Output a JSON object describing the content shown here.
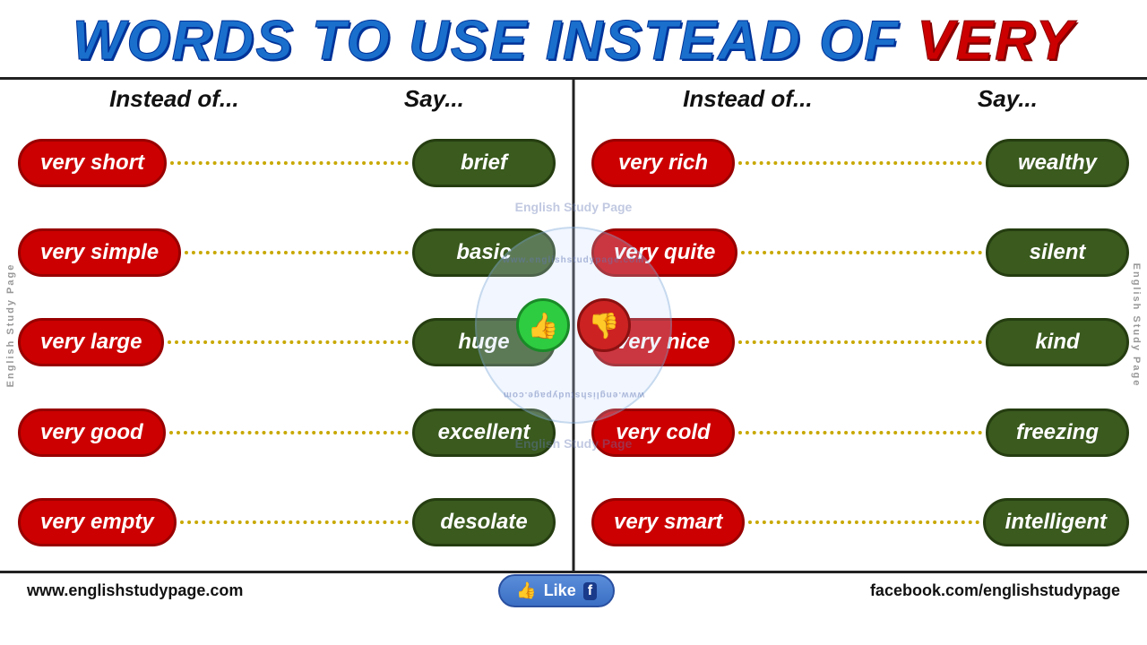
{
  "header": {
    "title_words": [
      {
        "text": "WORDS ",
        "color": "blue"
      },
      {
        "text": "TO ",
        "color": "blue"
      },
      {
        "text": "USE ",
        "color": "blue"
      },
      {
        "text": "INSTEAD ",
        "color": "blue"
      },
      {
        "text": "OF ",
        "color": "blue"
      },
      {
        "text": "VERY",
        "color": "red"
      }
    ],
    "title": "WORDS TO USE INSTEAD OF VERY"
  },
  "columns": {
    "instead_of": "Instead of...",
    "say": "Say..."
  },
  "left_pairs": [
    {
      "instead": "very short",
      "say": "brief"
    },
    {
      "instead": "very simple",
      "say": "basic"
    },
    {
      "instead": "very large",
      "say": "huge"
    },
    {
      "instead": "very good",
      "say": "excellent"
    },
    {
      "instead": "very empty",
      "say": "desolate"
    }
  ],
  "right_pairs": [
    {
      "instead": "very rich",
      "say": "wealthy"
    },
    {
      "instead": "very quite",
      "say": "silent"
    },
    {
      "instead": "very nice",
      "say": "kind"
    },
    {
      "instead": "very cold",
      "say": "freezing"
    },
    {
      "instead": "very smart",
      "say": "intelligent"
    }
  ],
  "watermark": {
    "url_text": "www.englishstudypage.com",
    "page_text": "English Study Page"
  },
  "footer": {
    "website": "www.englishstudypage.com",
    "facebook": "facebook.com/englishstudypage",
    "like_label": "Like"
  },
  "side_label": "English Study Page",
  "thumb_up": "👍",
  "thumb_down": "👎"
}
